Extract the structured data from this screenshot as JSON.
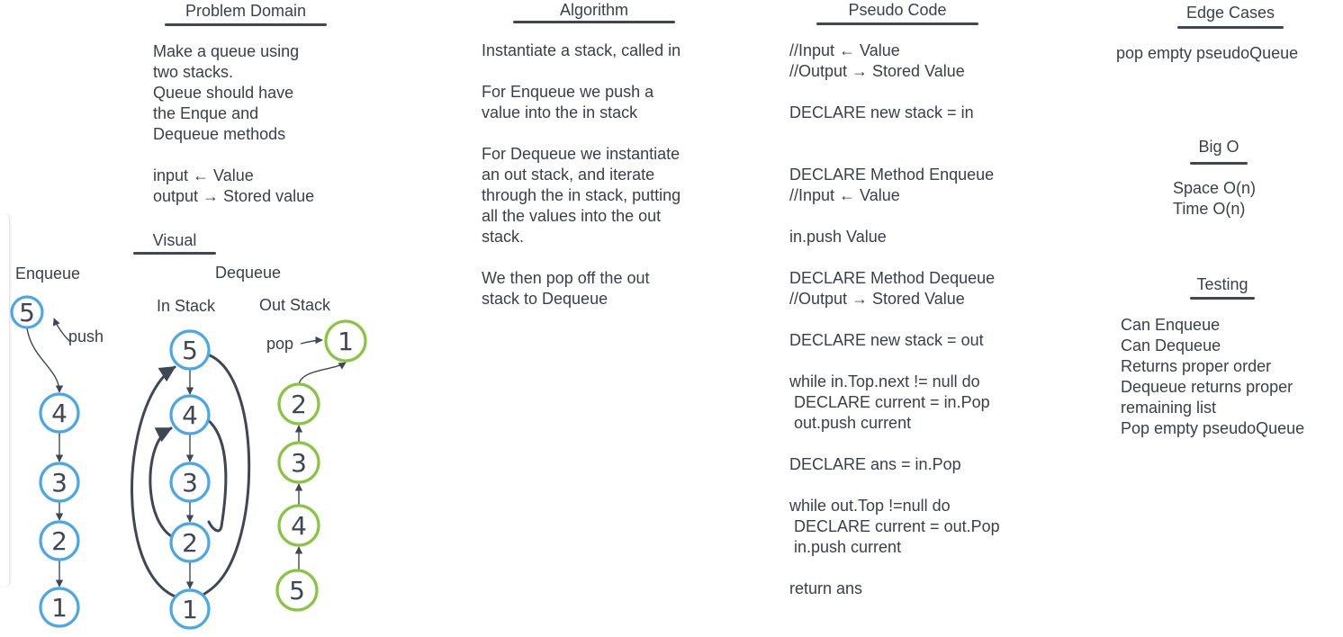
{
  "problem_domain": {
    "heading": "Problem Domain",
    "lines": [
      "Make a queue using",
      "two stacks.",
      "Queue should have",
      "the Enque and",
      "Dequeue methods",
      "",
      "input ← Value",
      "output → Stored value"
    ]
  },
  "algorithm": {
    "heading": "Algorithm",
    "lines": [
      "Instantiate a stack, called in",
      "",
      "For Enqueue we push a",
      "value into the in stack",
      "",
      "For Dequeue we instantiate",
      "an out stack, and iterate",
      "through the in stack, putting",
      "all the values into the out",
      "stack.",
      "",
      "We then pop off the out",
      "stack to Dequeue"
    ]
  },
  "pseudo_code": {
    "heading": "Pseudo Code",
    "lines": [
      "//Input ← Value",
      "//Output → Stored Value",
      "",
      "DECLARE new stack = in",
      "",
      "",
      "DECLARE Method Enqueue",
      "//Input ← Value",
      "",
      "in.push Value",
      "",
      "DECLARE Method Dequeue",
      "//Output → Stored Value",
      "",
      "DECLARE new stack = out",
      "",
      "while in.Top.next != null do",
      " DECLARE current = in.Pop",
      " out.push current",
      "",
      "DECLARE ans = in.Pop",
      "",
      "while out.Top !=null do",
      " DECLARE current = out.Pop",
      " in.push current",
      "",
      "return ans"
    ]
  },
  "edge_cases": {
    "heading": "Edge Cases",
    "lines": [
      "pop empty pseudoQueue"
    ]
  },
  "big_o": {
    "heading": "Big O",
    "lines": [
      "Space O(n)",
      "Time O(n)"
    ]
  },
  "testing": {
    "heading": "Testing",
    "lines": [
      "Can Enqueue",
      "Can Dequeue",
      "Returns proper order",
      "Dequeue returns proper",
      "remaining list",
      "Pop empty pseudoQueue"
    ]
  },
  "visual": {
    "heading": "Visual",
    "enqueue_label": "Enqueue",
    "dequeue_label": "Dequeue",
    "in_stack_label": "In Stack",
    "out_stack_label": "Out Stack",
    "push_label": "push",
    "pop_label": "pop",
    "enqueue_nodes": [
      "5",
      "4",
      "3",
      "2",
      "1"
    ],
    "in_stack_nodes": [
      "5",
      "4",
      "3",
      "2",
      "1"
    ],
    "out_stack_nodes": [
      "1",
      "2",
      "3",
      "4",
      "5"
    ]
  },
  "colors": {
    "blue_node": "#4aa7e8",
    "green_node": "#88c540",
    "stroke_dark": "#3f4656",
    "text": "#3b3f4c"
  }
}
